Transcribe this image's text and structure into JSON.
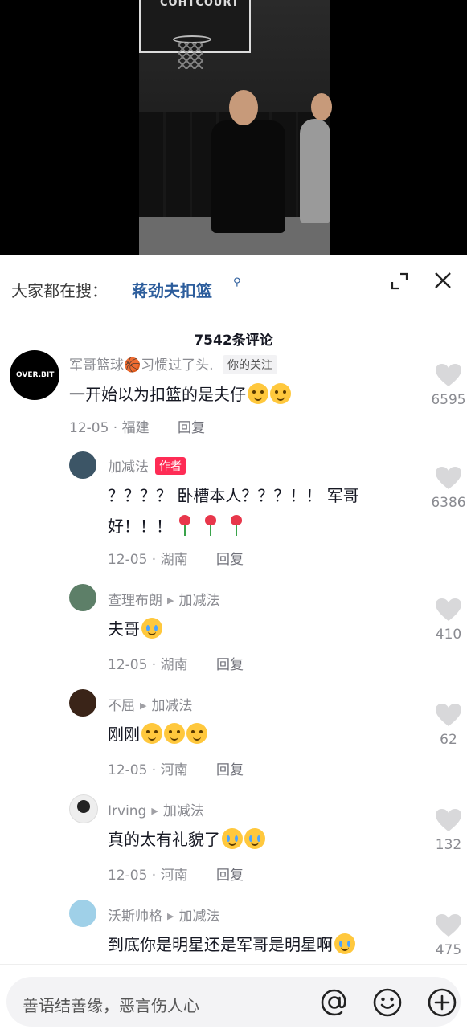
{
  "video": {
    "court_text": "COHTCOURT"
  },
  "search": {
    "prefix": "大家都在搜：",
    "term": "蒋劲夫扣篮",
    "search_glyph": "⚲"
  },
  "comment_count": "7542条评论",
  "comments": [
    {
      "username": "军哥篮球🏀习惯过了头.",
      "follow_tag": "你的关注",
      "avatar_text": "OVER.BIT",
      "text": "一开始以为扣篮的是夫仔",
      "meta": "12-05 · 福建",
      "reply": "回复",
      "likes": "6595"
    },
    {
      "username": "加减法",
      "author_tag": "作者",
      "text_line1": "？？？？ 卧槽本人？？？！！ 军哥",
      "text_line2": "好！！！",
      "meta": "12-05 · 湖南",
      "reply": "回复",
      "likes": "6386"
    },
    {
      "username": "查理布朗",
      "reply_to": "加减法",
      "text": "夫哥",
      "meta": "12-05 · 湖南",
      "reply": "回复",
      "likes": "410"
    },
    {
      "username": "不屈",
      "reply_to": "加减法",
      "text": "刚刚",
      "meta": "12-05 · 河南",
      "reply": "回复",
      "likes": "62"
    },
    {
      "username": "Irving",
      "reply_to": "加减法",
      "text": "真的太有礼貌了",
      "meta": "12-05 · 河南",
      "reply": "回复",
      "likes": "132"
    },
    {
      "username": "沃斯帅格",
      "reply_to": "加减法",
      "text": "到底你是明星还是军哥是明星啊",
      "likes": "475"
    }
  ],
  "input": {
    "placeholder": "善语结善缘，恶言伤人心"
  },
  "colors": {
    "accent_red": "#fe2c55",
    "link_blue": "#2c5d9c",
    "muted": "#8a8b91"
  }
}
